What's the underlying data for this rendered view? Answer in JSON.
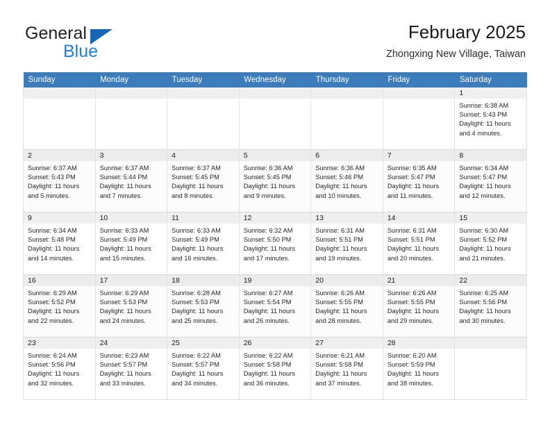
{
  "brand": {
    "name_top": "General",
    "name_bottom": "Blue",
    "triangle_color": "#1668b3",
    "blue_color": "#1c7fd4"
  },
  "header": {
    "title": "February 2025",
    "subtitle": "Zhongxing New Village, Taiwan"
  },
  "theme": {
    "header_row_bg": "#3c7cba",
    "header_row_text": "#ffffff",
    "daynum_bg": "#efefef",
    "grid_line": "#e2e2e2"
  },
  "weekdays": [
    "Sunday",
    "Monday",
    "Tuesday",
    "Wednesday",
    "Thursday",
    "Friday",
    "Saturday"
  ],
  "labels": {
    "sunrise": "Sunrise:",
    "sunset": "Sunset:",
    "daylight": "Daylight:"
  },
  "weeks": [
    [
      {
        "day": "",
        "sunrise": "",
        "sunset": "",
        "daylight_line1": "",
        "daylight_line2": ""
      },
      {
        "day": "",
        "sunrise": "",
        "sunset": "",
        "daylight_line1": "",
        "daylight_line2": ""
      },
      {
        "day": "",
        "sunrise": "",
        "sunset": "",
        "daylight_line1": "",
        "daylight_line2": ""
      },
      {
        "day": "",
        "sunrise": "",
        "sunset": "",
        "daylight_line1": "",
        "daylight_line2": ""
      },
      {
        "day": "",
        "sunrise": "",
        "sunset": "",
        "daylight_line1": "",
        "daylight_line2": ""
      },
      {
        "day": "",
        "sunrise": "",
        "sunset": "",
        "daylight_line1": "",
        "daylight_line2": ""
      },
      {
        "day": "1",
        "sunrise": "Sunrise: 6:38 AM",
        "sunset": "Sunset: 5:43 PM",
        "daylight_line1": "Daylight: 11 hours",
        "daylight_line2": "and 4 minutes."
      }
    ],
    [
      {
        "day": "2",
        "sunrise": "Sunrise: 6:37 AM",
        "sunset": "Sunset: 5:43 PM",
        "daylight_line1": "Daylight: 11 hours",
        "daylight_line2": "and 5 minutes."
      },
      {
        "day": "3",
        "sunrise": "Sunrise: 6:37 AM",
        "sunset": "Sunset: 5:44 PM",
        "daylight_line1": "Daylight: 11 hours",
        "daylight_line2": "and 7 minutes."
      },
      {
        "day": "4",
        "sunrise": "Sunrise: 6:37 AM",
        "sunset": "Sunset: 5:45 PM",
        "daylight_line1": "Daylight: 11 hours",
        "daylight_line2": "and 8 minutes."
      },
      {
        "day": "5",
        "sunrise": "Sunrise: 6:36 AM",
        "sunset": "Sunset: 5:45 PM",
        "daylight_line1": "Daylight: 11 hours",
        "daylight_line2": "and 9 minutes."
      },
      {
        "day": "6",
        "sunrise": "Sunrise: 6:36 AM",
        "sunset": "Sunset: 5:46 PM",
        "daylight_line1": "Daylight: 11 hours",
        "daylight_line2": "and 10 minutes."
      },
      {
        "day": "7",
        "sunrise": "Sunrise: 6:35 AM",
        "sunset": "Sunset: 5:47 PM",
        "daylight_line1": "Daylight: 11 hours",
        "daylight_line2": "and 11 minutes."
      },
      {
        "day": "8",
        "sunrise": "Sunrise: 6:34 AM",
        "sunset": "Sunset: 5:47 PM",
        "daylight_line1": "Daylight: 11 hours",
        "daylight_line2": "and 12 minutes."
      }
    ],
    [
      {
        "day": "9",
        "sunrise": "Sunrise: 6:34 AM",
        "sunset": "Sunset: 5:48 PM",
        "daylight_line1": "Daylight: 11 hours",
        "daylight_line2": "and 14 minutes."
      },
      {
        "day": "10",
        "sunrise": "Sunrise: 6:33 AM",
        "sunset": "Sunset: 5:49 PM",
        "daylight_line1": "Daylight: 11 hours",
        "daylight_line2": "and 15 minutes."
      },
      {
        "day": "11",
        "sunrise": "Sunrise: 6:33 AM",
        "sunset": "Sunset: 5:49 PM",
        "daylight_line1": "Daylight: 11 hours",
        "daylight_line2": "and 16 minutes."
      },
      {
        "day": "12",
        "sunrise": "Sunrise: 6:32 AM",
        "sunset": "Sunset: 5:50 PM",
        "daylight_line1": "Daylight: 11 hours",
        "daylight_line2": "and 17 minutes."
      },
      {
        "day": "13",
        "sunrise": "Sunrise: 6:31 AM",
        "sunset": "Sunset: 5:51 PM",
        "daylight_line1": "Daylight: 11 hours",
        "daylight_line2": "and 19 minutes."
      },
      {
        "day": "14",
        "sunrise": "Sunrise: 6:31 AM",
        "sunset": "Sunset: 5:51 PM",
        "daylight_line1": "Daylight: 11 hours",
        "daylight_line2": "and 20 minutes."
      },
      {
        "day": "15",
        "sunrise": "Sunrise: 6:30 AM",
        "sunset": "Sunset: 5:52 PM",
        "daylight_line1": "Daylight: 11 hours",
        "daylight_line2": "and 21 minutes."
      }
    ],
    [
      {
        "day": "16",
        "sunrise": "Sunrise: 6:29 AM",
        "sunset": "Sunset: 5:52 PM",
        "daylight_line1": "Daylight: 11 hours",
        "daylight_line2": "and 22 minutes."
      },
      {
        "day": "17",
        "sunrise": "Sunrise: 6:29 AM",
        "sunset": "Sunset: 5:53 PM",
        "daylight_line1": "Daylight: 11 hours",
        "daylight_line2": "and 24 minutes."
      },
      {
        "day": "18",
        "sunrise": "Sunrise: 6:28 AM",
        "sunset": "Sunset: 5:53 PM",
        "daylight_line1": "Daylight: 11 hours",
        "daylight_line2": "and 25 minutes."
      },
      {
        "day": "19",
        "sunrise": "Sunrise: 6:27 AM",
        "sunset": "Sunset: 5:54 PM",
        "daylight_line1": "Daylight: 11 hours",
        "daylight_line2": "and 26 minutes."
      },
      {
        "day": "20",
        "sunrise": "Sunrise: 6:26 AM",
        "sunset": "Sunset: 5:55 PM",
        "daylight_line1": "Daylight: 11 hours",
        "daylight_line2": "and 28 minutes."
      },
      {
        "day": "21",
        "sunrise": "Sunrise: 6:26 AM",
        "sunset": "Sunset: 5:55 PM",
        "daylight_line1": "Daylight: 11 hours",
        "daylight_line2": "and 29 minutes."
      },
      {
        "day": "22",
        "sunrise": "Sunrise: 6:25 AM",
        "sunset": "Sunset: 5:56 PM",
        "daylight_line1": "Daylight: 11 hours",
        "daylight_line2": "and 30 minutes."
      }
    ],
    [
      {
        "day": "23",
        "sunrise": "Sunrise: 6:24 AM",
        "sunset": "Sunset: 5:56 PM",
        "daylight_line1": "Daylight: 11 hours",
        "daylight_line2": "and 32 minutes."
      },
      {
        "day": "24",
        "sunrise": "Sunrise: 6:23 AM",
        "sunset": "Sunset: 5:57 PM",
        "daylight_line1": "Daylight: 11 hours",
        "daylight_line2": "and 33 minutes."
      },
      {
        "day": "25",
        "sunrise": "Sunrise: 6:22 AM",
        "sunset": "Sunset: 5:57 PM",
        "daylight_line1": "Daylight: 11 hours",
        "daylight_line2": "and 34 minutes."
      },
      {
        "day": "26",
        "sunrise": "Sunrise: 6:22 AM",
        "sunset": "Sunset: 5:58 PM",
        "daylight_line1": "Daylight: 11 hours",
        "daylight_line2": "and 36 minutes."
      },
      {
        "day": "27",
        "sunrise": "Sunrise: 6:21 AM",
        "sunset": "Sunset: 5:58 PM",
        "daylight_line1": "Daylight: 11 hours",
        "daylight_line2": "and 37 minutes."
      },
      {
        "day": "28",
        "sunrise": "Sunrise: 6:20 AM",
        "sunset": "Sunset: 5:59 PM",
        "daylight_line1": "Daylight: 11 hours",
        "daylight_line2": "and 38 minutes."
      },
      {
        "day": "",
        "sunrise": "",
        "sunset": "",
        "daylight_line1": "",
        "daylight_line2": ""
      }
    ]
  ]
}
